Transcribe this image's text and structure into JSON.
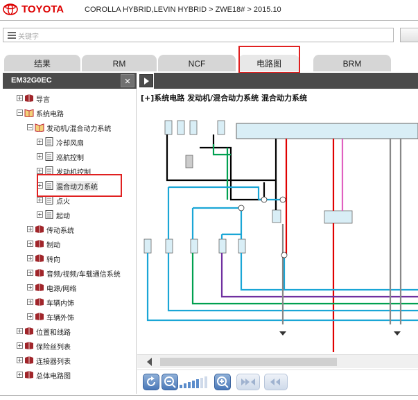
{
  "header": {
    "brand": "TOYOTA",
    "breadcrumb": "COROLLA HYBRID,LEVIN HYBRID > ZWE18# > 2015.10"
  },
  "search": {
    "placeholder": "关键字",
    "icon": "search-icon"
  },
  "tabs": [
    {
      "label": "结果"
    },
    {
      "label": "RM"
    },
    {
      "label": "NCF"
    },
    {
      "label": "电路图",
      "active": true
    },
    {
      "label": "BRM"
    }
  ],
  "panel": {
    "title": "EM32G0EC",
    "close_label": "✕"
  },
  "tree": [
    {
      "label": "导言",
      "toggle": "+",
      "icon": "book-icon"
    },
    {
      "label": "系统电路",
      "toggle": "−",
      "icon": "open-book-icon"
    },
    {
      "label": "发动机/混合动力系统",
      "toggle": "−",
      "icon": "open-book-icon"
    },
    {
      "label": "冷却风扇",
      "toggle": "+",
      "icon": "document-icon"
    },
    {
      "label": "巡航控制",
      "toggle": "+",
      "icon": "document-icon"
    },
    {
      "label": "发动机控制",
      "toggle": "+",
      "icon": "document-icon"
    },
    {
      "label": "混合动力系统",
      "toggle": "+",
      "icon": "document-icon",
      "selected": true
    },
    {
      "label": "点火",
      "toggle": "+",
      "icon": "document-icon"
    },
    {
      "label": "起动",
      "toggle": "+",
      "icon": "document-icon"
    },
    {
      "label": "传动系统",
      "toggle": "+",
      "icon": "book-icon"
    },
    {
      "label": "制动",
      "toggle": "+",
      "icon": "book-icon"
    },
    {
      "label": "转向",
      "toggle": "+",
      "icon": "book-icon"
    },
    {
      "label": "音频/视频/车载通信系统",
      "toggle": "+",
      "icon": "book-icon"
    },
    {
      "label": "电源/网络",
      "toggle": "+",
      "icon": "book-icon"
    },
    {
      "label": "车辆内饰",
      "toggle": "+",
      "icon": "book-icon"
    },
    {
      "label": "车辆外饰",
      "toggle": "+",
      "icon": "book-icon"
    },
    {
      "label": "位置和线路",
      "toggle": "+",
      "icon": "book-icon"
    },
    {
      "label": "保险丝列表",
      "toggle": "+",
      "icon": "book-icon"
    },
    {
      "label": "连接器列表",
      "toggle": "+",
      "icon": "book-icon"
    },
    {
      "label": "总体电路图",
      "toggle": "+",
      "icon": "book-icon"
    }
  ],
  "diagram": {
    "title": "[+]系统电路  发动机/混合动力系统  混合动力系统"
  },
  "toolbar": {
    "buttons": [
      "refresh-icon",
      "zoom-out-icon",
      "zoom-in-icon",
      "first-page-icon",
      "previous-page-icon"
    ]
  },
  "colors": {
    "accent": "#4a78b8",
    "highlight": "#e02020",
    "brand": "#dd0000"
  }
}
